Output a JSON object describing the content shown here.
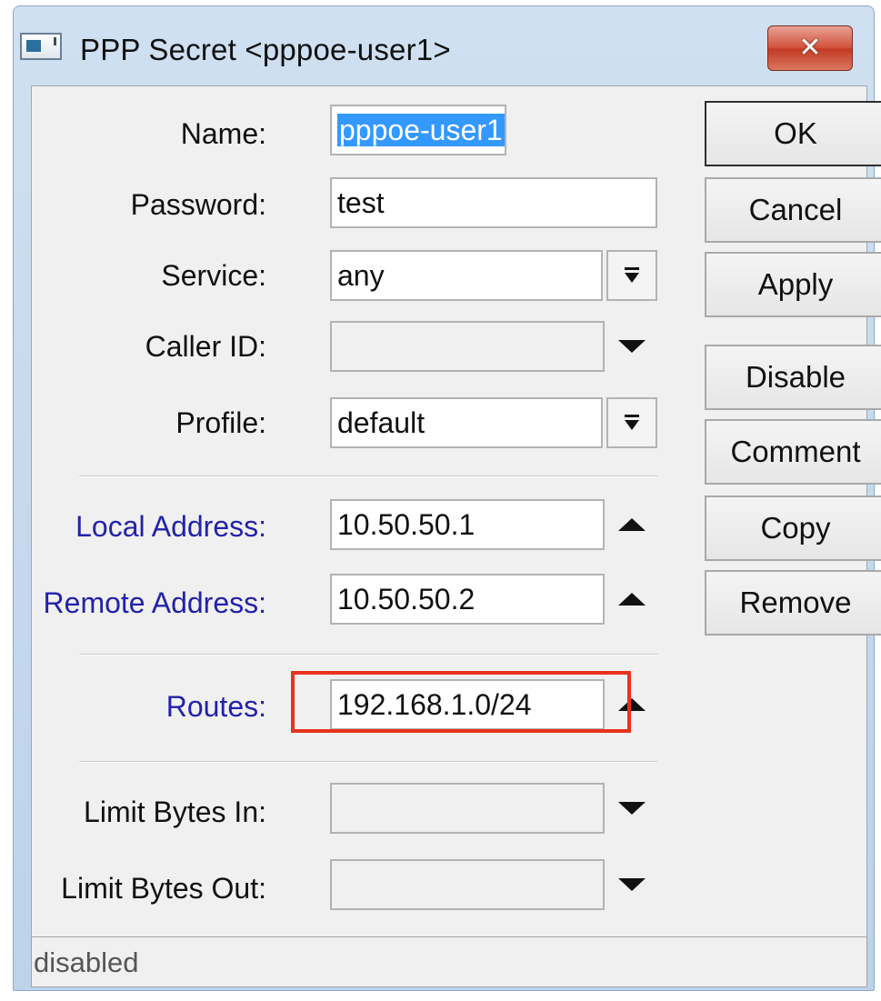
{
  "window": {
    "title": "PPP Secret <pppoe-user1>",
    "close_symbol": "✕",
    "icon": "window-app-icon"
  },
  "form": {
    "name": {
      "label": "Name:",
      "value": "pppoe-user1",
      "selected": true
    },
    "password": {
      "label": "Password:",
      "value": "test"
    },
    "service": {
      "label": "Service:",
      "value": "any",
      "control_icon": "dropdown-expand-icon"
    },
    "caller_id": {
      "label": "Caller ID:",
      "value": "",
      "control_icon": "triangle-down-icon"
    },
    "profile": {
      "label": "Profile:",
      "value": "default",
      "control_icon": "dropdown-expand-icon"
    },
    "local_address": {
      "label": "Local Address:",
      "value": "10.50.50.1",
      "control_icon": "triangle-up-icon"
    },
    "remote_address": {
      "label": "Remote Address:",
      "value": "10.50.50.2",
      "control_icon": "triangle-up-icon"
    },
    "routes": {
      "label": "Routes:",
      "value": "192.168.1.0/24",
      "control_icon": "triangle-up-icon",
      "highlighted": true
    },
    "limit_bytes_in": {
      "label": "Limit Bytes In:",
      "value": "",
      "control_icon": "triangle-down-icon"
    },
    "limit_bytes_out": {
      "label": "Limit Bytes Out:",
      "value": "",
      "control_icon": "triangle-down-icon"
    }
  },
  "buttons": {
    "ok": "OK",
    "cancel": "Cancel",
    "apply": "Apply",
    "disable": "Disable",
    "comment": "Comment",
    "copy": "Copy",
    "remove": "Remove"
  },
  "status": {
    "text": "disabled"
  },
  "colors": {
    "label_link": "#2222aa",
    "highlight_box": "#e8321d",
    "selection": "#3399ff",
    "close_button": "#c43a24"
  }
}
